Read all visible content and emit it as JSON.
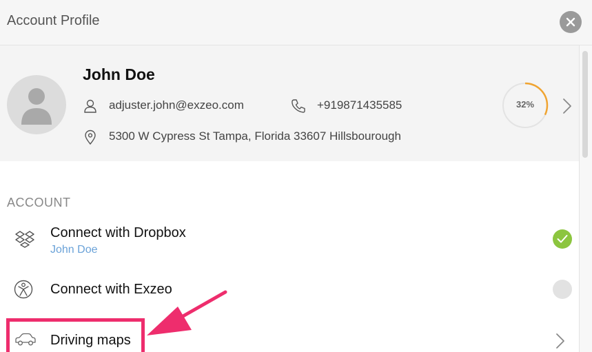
{
  "header": {
    "title": "Account Profile"
  },
  "profile": {
    "name": "John Doe",
    "email": "adjuster.john@exzeo.com",
    "phone": "+919871435585",
    "address": "5300 W Cypress St Tampa, Florida 33607 Hillsbourough",
    "completion_label": "32%",
    "completion_fraction": 0.32
  },
  "account": {
    "section_label": "ACCOUNT",
    "items": [
      {
        "label": "Connect with Dropbox",
        "sub": "John Doe",
        "connected": true
      },
      {
        "label": "Connect with Exzeo",
        "sub": "",
        "connected": false
      },
      {
        "label": "Driving maps"
      }
    ]
  },
  "colors": {
    "progress_accent": "#f0a431",
    "connected": "#8cc53f",
    "link": "#6aa2d8",
    "annotation": "#ee2d6d"
  }
}
